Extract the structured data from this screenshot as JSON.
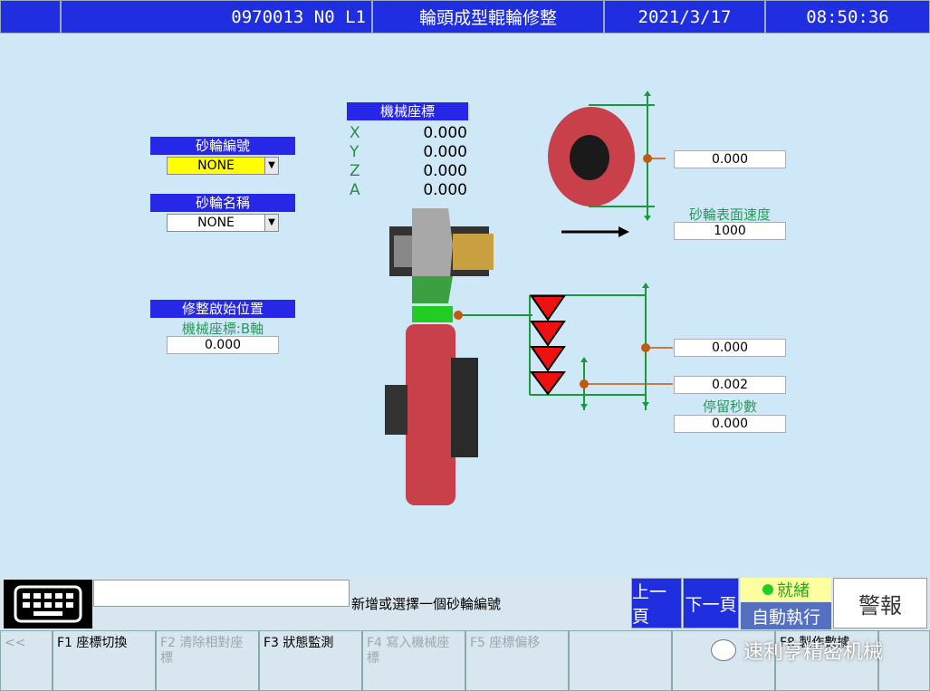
{
  "header": {
    "program": "0970013 N0 L1",
    "title": "輪頭成型輥輪修整",
    "date": "2021/3/17",
    "time": "08:50:36"
  },
  "mech_coord": {
    "title": "機械座標",
    "axes": [
      {
        "axis": "X",
        "value": "0.000"
      },
      {
        "axis": "Y",
        "value": "0.000"
      },
      {
        "axis": "Z",
        "value": "0.000"
      },
      {
        "axis": "A",
        "value": "0.000"
      }
    ]
  },
  "wheel_number": {
    "label": "砂輪編號",
    "value": "NONE"
  },
  "wheel_name": {
    "label": "砂輪名稱",
    "value": "NONE"
  },
  "dress_start": {
    "label": "修整啟始位置",
    "sublabel": "機械座標:B軸",
    "value": "0.000"
  },
  "right_panel": {
    "top_value": "0.000",
    "surface_speed_label": "砂輪表面速度",
    "surface_speed_value": "1000",
    "depth_value": "0.000",
    "step_value": "0.002",
    "dwell_label": "停留秒數",
    "dwell_value": "0.000"
  },
  "status_bar": {
    "message": "新增或選擇一個砂輪編號",
    "input_value": "",
    "prev_page": "上一頁",
    "next_page": "下一頁",
    "ready": "就緒",
    "auto": "自動執行",
    "alarm": "警報"
  },
  "fkeys": [
    {
      "label": "<<",
      "enabled": false
    },
    {
      "label": "F1 座標切換",
      "enabled": true
    },
    {
      "label": "F2 清除相對座標",
      "enabled": false
    },
    {
      "label": "F3 狀態監測",
      "enabled": true
    },
    {
      "label": "F4 寫入機械座標",
      "enabled": false
    },
    {
      "label": "F5 座標偏移",
      "enabled": false
    },
    {
      "label": "",
      "enabled": false
    },
    {
      "label": "",
      "enabled": false
    },
    {
      "label": "F8 製作數據",
      "enabled": true
    },
    {
      "label": "",
      "enabled": false
    }
  ],
  "watermark": "速利亨精密机械",
  "colors": {
    "header_blue": "#1f2fe0",
    "label_blue": "#2727e8",
    "background": "#cfe8f7",
    "ready_green": "#22cc22",
    "wheel_red": "#c8404a"
  }
}
